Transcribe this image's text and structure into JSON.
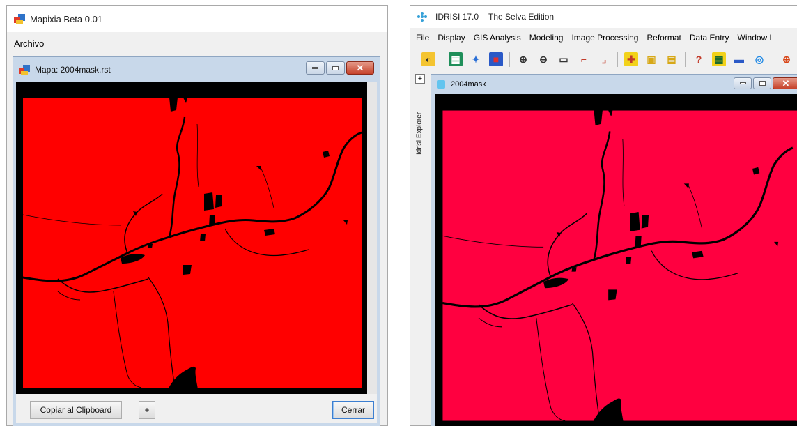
{
  "mapixia": {
    "app_title": "Mapixia Beta 0.01",
    "menu": [
      "Archivo"
    ],
    "map_window": {
      "title": "Mapa: 2004mask.rst",
      "buttons": {
        "copy_label": "Copiar al Clipboard",
        "plus_label": "+",
        "close_label": "Cerrar"
      }
    },
    "mask_color": "#ff0000"
  },
  "idrisi": {
    "app_title": "IDRISI 17.0",
    "edition": "The Selva Edition",
    "menu": [
      "File",
      "Display",
      "GIS Analysis",
      "Modeling",
      "Image Processing",
      "Reformat",
      "Data Entry",
      "Window L"
    ],
    "explorer_toggle": "+",
    "explorer_label": "Idrisi Explorer",
    "map_window": {
      "title": "2004mask"
    },
    "mask_color": "#ff0040",
    "toolbar_icons": [
      "layer-icon",
      "composite-icon",
      "vector-icon",
      "palette-icon",
      "zoom-in-icon",
      "zoom-out-icon",
      "zoom-window-icon",
      "pan-left-icon",
      "pan-right-icon",
      "measure-icon",
      "group-icon",
      "link-icon",
      "query-icon",
      "attribute-table-icon",
      "scale-bar-icon",
      "globe-icon",
      "target-icon"
    ]
  }
}
